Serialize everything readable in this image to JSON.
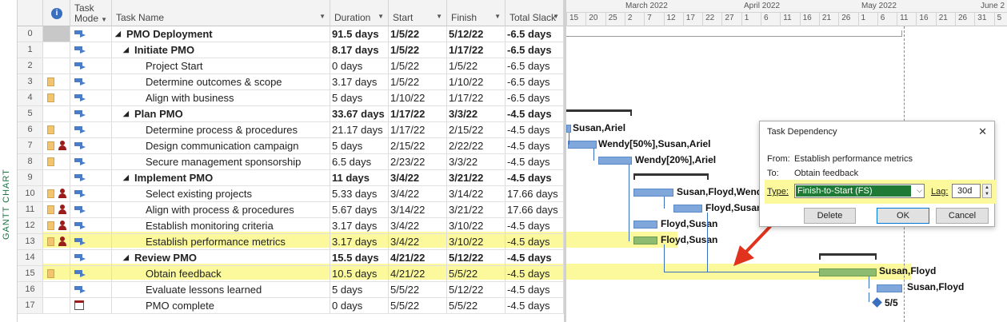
{
  "view_label": "GANTT CHART",
  "columns": {
    "mode": "Task Mode",
    "name": "Task Name",
    "duration": "Duration",
    "start": "Start",
    "finish": "Finish",
    "slack": "Total Slack"
  },
  "timeline": {
    "months": [
      "March 2022",
      "April 2022",
      "May 2022",
      "June 2"
    ],
    "days": [
      "15",
      "20",
      "25",
      "2",
      "7",
      "12",
      "17",
      "22",
      "27",
      "1",
      "6",
      "11",
      "16",
      "21",
      "26",
      "1",
      "6",
      "11",
      "16",
      "21",
      "26",
      "31",
      "5"
    ]
  },
  "rows": [
    {
      "id": "0",
      "name": "PMO Deployment",
      "duration": "91.5 days",
      "start": "1/5/22",
      "finish": "5/12/22",
      "slack": "-6.5 days",
      "level": 0,
      "summary": true,
      "note": false,
      "person": false
    },
    {
      "id": "1",
      "name": "Initiate PMO",
      "duration": "8.17 days",
      "start": "1/5/22",
      "finish": "1/17/22",
      "slack": "-6.5 days",
      "level": 1,
      "summary": true,
      "note": false,
      "person": false
    },
    {
      "id": "2",
      "name": "Project Start",
      "duration": "0 days",
      "start": "1/5/22",
      "finish": "1/5/22",
      "slack": "-6.5 days",
      "level": 2,
      "summary": false,
      "note": false,
      "person": false
    },
    {
      "id": "3",
      "name": "Determine outcomes & scope",
      "duration": "3.17 days",
      "start": "1/5/22",
      "finish": "1/10/22",
      "slack": "-6.5 days",
      "level": 2,
      "summary": false,
      "note": true,
      "person": false
    },
    {
      "id": "4",
      "name": "Align with business",
      "duration": "5 days",
      "start": "1/10/22",
      "finish": "1/17/22",
      "slack": "-6.5 days",
      "level": 2,
      "summary": false,
      "note": true,
      "person": false
    },
    {
      "id": "5",
      "name": "Plan PMO",
      "duration": "33.67 days",
      "start": "1/17/22",
      "finish": "3/3/22",
      "slack": "-4.5 days",
      "level": 1,
      "summary": true,
      "note": false,
      "person": false
    },
    {
      "id": "6",
      "name": "Determine process & procedures",
      "duration": "21.17 days",
      "start": "1/17/22",
      "finish": "2/15/22",
      "slack": "-4.5 days",
      "level": 2,
      "summary": false,
      "note": true,
      "person": false
    },
    {
      "id": "7",
      "name": "Design communication campaign",
      "duration": "5 days",
      "start": "2/15/22",
      "finish": "2/22/22",
      "slack": "-4.5 days",
      "level": 2,
      "summary": false,
      "note": true,
      "person": true
    },
    {
      "id": "8",
      "name": "Secure management sponsorship",
      "duration": "6.5 days",
      "start": "2/23/22",
      "finish": "3/3/22",
      "slack": "-4.5 days",
      "level": 2,
      "summary": false,
      "note": true,
      "person": false
    },
    {
      "id": "9",
      "name": "Implement PMO",
      "duration": "11 days",
      "start": "3/4/22",
      "finish": "3/21/22",
      "slack": "-4.5 days",
      "level": 1,
      "summary": true,
      "note": false,
      "person": false
    },
    {
      "id": "10",
      "name": "Select existing projects",
      "duration": "5.33 days",
      "start": "3/4/22",
      "finish": "3/14/22",
      "slack": "17.66 days",
      "level": 2,
      "summary": false,
      "note": true,
      "person": true
    },
    {
      "id": "11",
      "name": "Align with process & procedures",
      "duration": "5.67 days",
      "start": "3/14/22",
      "finish": "3/21/22",
      "slack": "17.66 days",
      "level": 2,
      "summary": false,
      "note": true,
      "person": true
    },
    {
      "id": "12",
      "name": "Establish monitoring criteria",
      "duration": "3.17 days",
      "start": "3/4/22",
      "finish": "3/10/22",
      "slack": "-4.5 days",
      "level": 2,
      "summary": false,
      "note": true,
      "person": true
    },
    {
      "id": "13",
      "name": "Establish performance metrics",
      "duration": "3.17 days",
      "start": "3/4/22",
      "finish": "3/10/22",
      "slack": "-4.5 days",
      "level": 2,
      "summary": false,
      "note": true,
      "person": true
    },
    {
      "id": "14",
      "name": "Review PMO",
      "duration": "15.5 days",
      "start": "4/21/22",
      "finish": "5/12/22",
      "slack": "-4.5 days",
      "level": 1,
      "summary": true,
      "note": false,
      "person": false
    },
    {
      "id": "15",
      "name": "Obtain feedback",
      "duration": "10.5 days",
      "start": "4/21/22",
      "finish": "5/5/22",
      "slack": "-4.5 days",
      "level": 2,
      "summary": false,
      "note": true,
      "person": false
    },
    {
      "id": "16",
      "name": "Evaluate lessons learned",
      "duration": "5 days",
      "start": "5/5/22",
      "finish": "5/12/22",
      "slack": "-4.5 days",
      "level": 2,
      "summary": false,
      "note": false,
      "person": false
    },
    {
      "id": "17",
      "name": "PMO complete",
      "duration": "0 days",
      "start": "5/5/22",
      "finish": "5/5/22",
      "slack": "-4.5 days",
      "level": 2,
      "summary": false,
      "note": false,
      "person": false
    }
  ],
  "gantt_labels": {
    "r6": "Susan,Ariel",
    "r7": "Wendy[50%],Susan,Ariel",
    "r8": "Wendy[20%],Ariel",
    "r10": "Susan,Floyd,Wendy",
    "r11": "Floyd,Susan,",
    "r12": "Floyd,Susan",
    "r13": "Floyd,Susan",
    "r15": "Susan,Floyd",
    "r16": "Susan,Floyd",
    "r17": "5/5"
  },
  "dialog": {
    "title": "Task Dependency",
    "from_label": "From:",
    "from_value": "Establish performance metrics",
    "to_label": "To:",
    "to_value": "Obtain feedback",
    "type_label": "Type:",
    "type_value": "Finish-to-Start (FS)",
    "lag_label": "Lag:",
    "lag_value": "30d",
    "delete": "Delete",
    "ok": "OK",
    "cancel": "Cancel",
    "close": "✕"
  },
  "colors": {
    "highlight": "#fbf99b",
    "accent": "#217346",
    "arrow": "#e0321c"
  }
}
